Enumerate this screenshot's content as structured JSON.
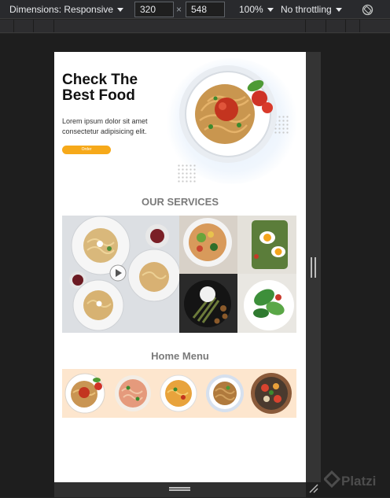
{
  "devtools": {
    "dimensions_label": "Dimensions: Responsive",
    "width_value": "320",
    "height_value": "548",
    "times_sign": "×",
    "zoom_label": "100%",
    "throttle_label": "No throttling",
    "rotate_icon": "rotate-icon"
  },
  "page": {
    "hero": {
      "title": "Check The Best Food",
      "body": "Lorem ipsum dolor sit amet consectetur adipisicing elit.",
      "button_label": "Order"
    },
    "services_title": "OUR SERVICES",
    "menu_title": "Home Menu",
    "menu_items": [
      "pasta-dish",
      "pasta-salad-dish",
      "pasta-bowl",
      "noodles-plate",
      "mixed-veg-bowl"
    ]
  },
  "colors": {
    "accent_orange": "#f6a91a",
    "menu_band": "#fde6ce",
    "heading_gray": "#7a7a7a"
  },
  "watermark": "Platzi"
}
